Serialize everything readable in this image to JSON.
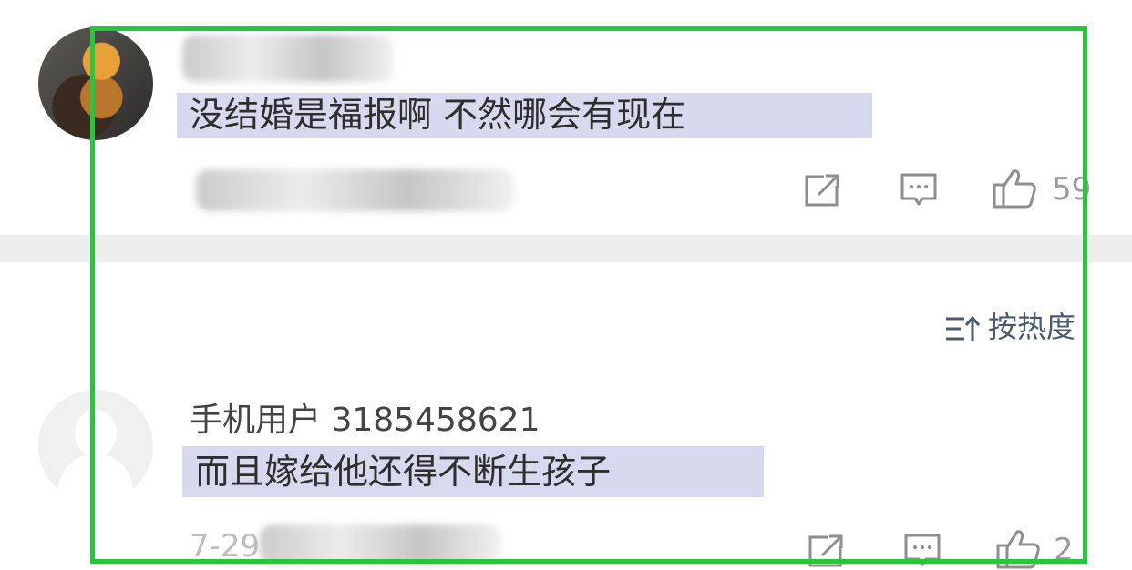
{
  "comments": [
    {
      "text": "没结婚是福报啊 不然哪会有现在",
      "like_count": "59"
    },
    {
      "username": "手机用户 3185458621",
      "text": "而且嫁给他还得不断生孩子",
      "meta_date": "7-29",
      "like_count": "2"
    }
  ],
  "sort": {
    "label": "按热度"
  },
  "icons": {
    "share": "share-icon",
    "reply": "reply-icon",
    "like": "thumbs-up-icon",
    "sort": "sort-icon"
  },
  "colors": {
    "highlight": "#d8d8ee",
    "annotation_box": "#28c53d",
    "divider": "#eeeeee"
  }
}
